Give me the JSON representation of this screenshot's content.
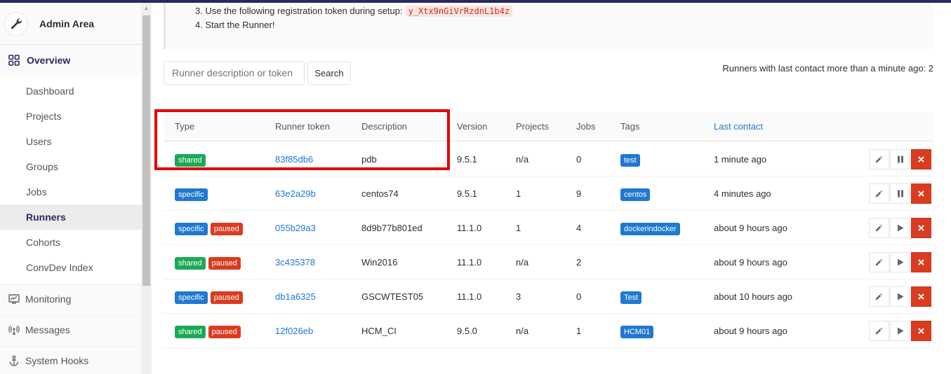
{
  "sidebar": {
    "title": "Admin Area",
    "overview_label": "Overview",
    "sub_items": [
      "Dashboard",
      "Projects",
      "Users",
      "Groups",
      "Jobs",
      "Runners",
      "Cohorts",
      "ConvDev Index"
    ],
    "active_item": "Runners",
    "sections": [
      "Monitoring",
      "Messages",
      "System Hooks"
    ]
  },
  "instructions": {
    "step3_text": "3. Use the following registration token during setup:",
    "registration_token": "y_Xtx9nGiVrRzdnL1b4z",
    "step4_text": "4. Start the Runner!"
  },
  "search": {
    "placeholder": "Runner description or token",
    "button_label": "Search"
  },
  "contact_note": "Runners with last contact more than a minute ago: 2",
  "table": {
    "headers": {
      "type": "Type",
      "token": "Runner token",
      "description": "Description",
      "version": "Version",
      "projects": "Projects",
      "jobs": "Jobs",
      "tags": "Tags",
      "last_contact": "Last contact"
    },
    "rows": [
      {
        "badges": [
          "shared"
        ],
        "token": "83f85db6",
        "description": "pdb",
        "version": "9.5.1",
        "projects": "n/a",
        "jobs": "0",
        "tag": "test",
        "last_contact": "1 minute ago",
        "paused": false
      },
      {
        "badges": [
          "specific"
        ],
        "token": "63e2a29b",
        "description": "centos74",
        "version": "9.5.1",
        "projects": "1",
        "jobs": "9",
        "tag": "centos",
        "last_contact": "4 minutes ago",
        "paused": false
      },
      {
        "badges": [
          "specific",
          "paused"
        ],
        "token": "055b29a3",
        "description": "8d9b77b801ed",
        "version": "11.1.0",
        "projects": "1",
        "jobs": "4",
        "tag": "dockerindocker",
        "last_contact": "about 9 hours ago",
        "paused": true
      },
      {
        "badges": [
          "shared",
          "paused"
        ],
        "token": "3c435378",
        "description": "Win2016",
        "version": "11.1.0",
        "projects": "n/a",
        "jobs": "2",
        "tag": "",
        "last_contact": "about 9 hours ago",
        "paused": true
      },
      {
        "badges": [
          "specific",
          "paused"
        ],
        "token": "db1a6325",
        "description": "GSCWTEST05",
        "version": "11.1.0",
        "projects": "3",
        "jobs": "0",
        "tag": "Test",
        "last_contact": "about 10 hours ago",
        "paused": true
      },
      {
        "badges": [
          "shared",
          "paused"
        ],
        "token": "12f026eb",
        "description": "HCM_CI",
        "version": "9.5.0",
        "projects": "n/a",
        "jobs": "1",
        "tag": "HCM01",
        "last_contact": "about 9 hours ago",
        "paused": true
      }
    ]
  },
  "colors": {
    "brand": "#292961",
    "link": "#1f78d1",
    "shared": "#1aaa55",
    "paused": "#db3b21",
    "highlight": "#e50000"
  },
  "icons": {
    "admin": "wrench-icon",
    "overview": "grid-icon",
    "monitoring": "monitor-icon",
    "messages": "broadcast-icon",
    "hooks": "anchor-icon",
    "edit": "pencil-icon",
    "pause": "pause-icon",
    "resume": "play-icon",
    "remove": "close-icon"
  }
}
